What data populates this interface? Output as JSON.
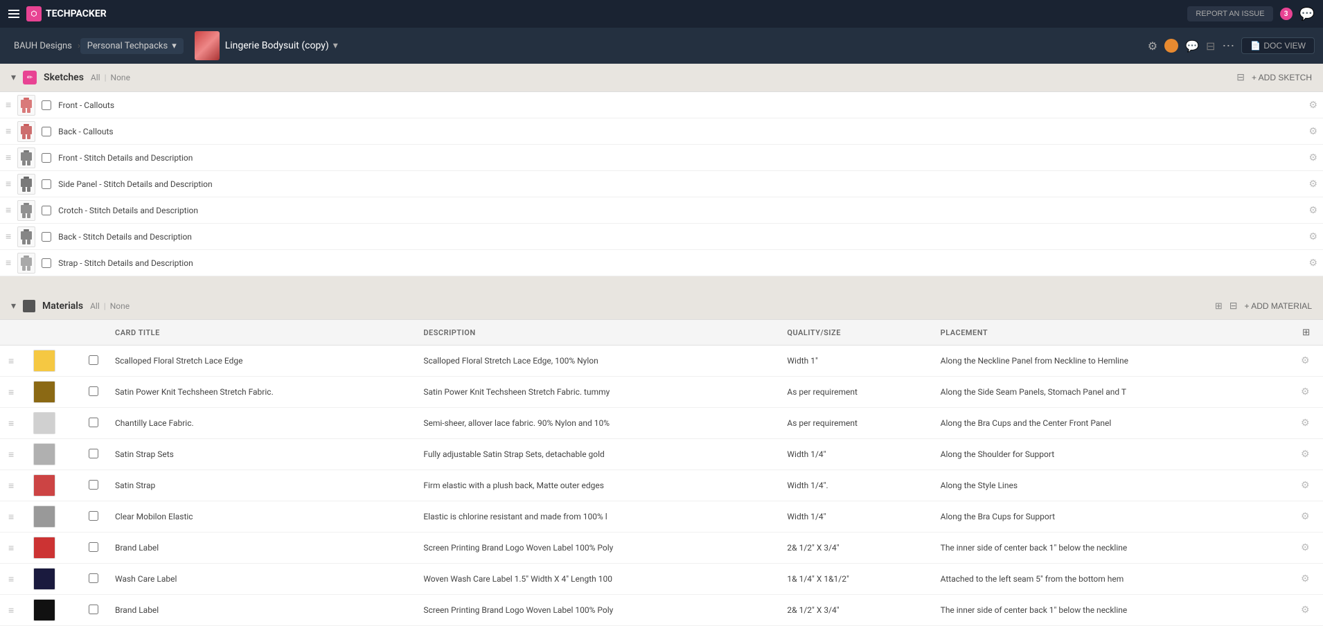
{
  "topNav": {
    "brand": "TECHPACKER",
    "reportIssue": "REPORT AN ISSUE",
    "notifCount": "3"
  },
  "subNav": {
    "breadcrumb1": "BAUH Designs",
    "breadcrumb2": "Personal Techpacks",
    "garmentTitle": "Lingerie Bodysuit (copy)",
    "docView": "DOC VIEW"
  },
  "sketches": {
    "sectionTitle": "Sketches",
    "filterAll": "All",
    "filterNone": "None",
    "addButton": "+ ADD SKETCH",
    "rows": [
      {
        "id": 1,
        "name": "Front - Callouts",
        "thumbColor": "#c44"
      },
      {
        "id": 2,
        "name": "Back - Callouts",
        "thumbColor": "#b33"
      },
      {
        "id": 3,
        "name": "Front - Stitch Details and Description",
        "thumbColor": "#555"
      },
      {
        "id": 4,
        "name": "Side Panel - Stitch Details and Description",
        "thumbColor": "#444"
      },
      {
        "id": 5,
        "name": "Crotch - Stitch Details and Description",
        "thumbColor": "#666"
      },
      {
        "id": 6,
        "name": "Back - Stitch Details and Description",
        "thumbColor": "#555"
      },
      {
        "id": 7,
        "name": "Strap - Stitch Details and Description",
        "thumbColor": "#888"
      }
    ]
  },
  "materials": {
    "sectionTitle": "Materials",
    "filterAll": "All",
    "filterNone": "None",
    "addButton": "+ ADD MATERIAL",
    "columns": {
      "cardTitle": "Card Title",
      "description": "DESCRIPTION",
      "qualitySize": "QUALITY/SIZE",
      "placement": "PLACEMENT"
    },
    "rows": [
      {
        "id": 1,
        "thumbColor": "#f5c842",
        "name": "Scalloped Floral Stretch Lace Edge",
        "description": "Scalloped Floral Stretch Lace Edge, 100% Nylon",
        "quality": "Width 1\"",
        "placement": "Along the Neckline Panel from Neckline to Hemline"
      },
      {
        "id": 2,
        "thumbColor": "#8B6914",
        "name": "Satin Power Knit Techsheen Stretch Fabric.",
        "description": "Satin Power Knit Techsheen Stretch Fabric. tummy",
        "quality": "As per requirement",
        "placement": "Along the Side Seam Panels, Stomach Panel and T"
      },
      {
        "id": 3,
        "thumbColor": "#d0d0d0",
        "name": "Chantilly Lace Fabric.",
        "description": "Semi-sheer, allover lace fabric. 90% Nylon and 10%",
        "quality": "As per requirement",
        "placement": "Along the Bra Cups and the Center Front Panel"
      },
      {
        "id": 4,
        "thumbColor": "#b0b0b0",
        "name": "Satin Strap Sets",
        "description": "Fully adjustable Satin Strap Sets, detachable gold",
        "quality": "Width 1/4\"",
        "placement": "Along the Shoulder for Support"
      },
      {
        "id": 5,
        "thumbColor": "#c44",
        "name": "Satin Strap",
        "description": "Firm elastic with a plush back, Matte outer edges",
        "quality": "Width 1/4\".",
        "placement": "Along the Style Lines"
      },
      {
        "id": 6,
        "thumbColor": "#999",
        "name": "Clear Mobilon Elastic",
        "description": "Elastic is chlorine resistant and made from 100% l",
        "quality": "Width 1/4\"",
        "placement": "Along the Bra Cups for Support"
      },
      {
        "id": 7,
        "thumbColor": "#cc3333",
        "name": "Brand Label",
        "description": "Screen Printing Brand Logo Woven Label 100% Poly",
        "quality": "2& 1/2\"  X 3/4\"",
        "placement": "The inner side of center back 1\" below the neckline"
      },
      {
        "id": 8,
        "thumbColor": "#1a1a3e",
        "name": "Wash Care Label",
        "description": "Woven Wash Care Label 1.5\" Width X 4\" Length 100",
        "quality": "1& 1/4\" X 1&1/2\"",
        "placement": "Attached to the left seam 5\" from the bottom hem"
      },
      {
        "id": 9,
        "thumbColor": "#111",
        "name": "Brand Label",
        "description": "Screen Printing Brand Logo Woven Label 100% Poly",
        "quality": "2& 1/2\"  X 3/4\"",
        "placement": "The inner side of center back 1\" below the neckline"
      }
    ]
  }
}
